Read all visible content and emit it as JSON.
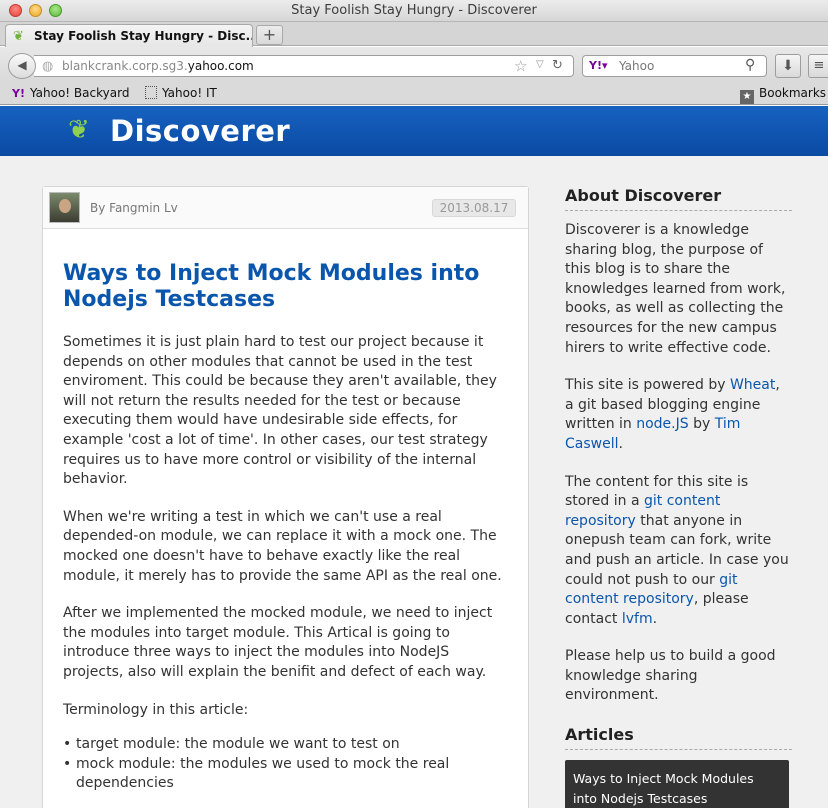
{
  "window": {
    "title": "Stay Foolish Stay Hungry - Discoverer"
  },
  "tab": {
    "label": "Stay Foolish Stay Hungry - Disc...",
    "new_tab": "+"
  },
  "urlbar": {
    "prefix": "blankcrank.corp.sg3.",
    "host": "yahoo.com"
  },
  "search": {
    "placeholder": "Yahoo"
  },
  "bookmarks": {
    "items": [
      "Yahoo! Backyard",
      "Yahoo! IT"
    ],
    "bookmarks_label": "Bookmarks"
  },
  "site": {
    "name": "Discoverer"
  },
  "post": {
    "author": "By Fangmin Lv",
    "date": "2013.08.17",
    "title": "Ways to Inject Mock Modules into Nodejs Testcases",
    "paragraphs": [
      "Sometimes it is just plain hard to test our project because it depends on other modules that cannot be used in the test enviroment. This could be because they aren't available, they will not return the results needed for the test or because executing them would have undesirable side effects, for example 'cost a lot of time'. In other cases, our test strategy requires us to have more control or visibility of the internal behavior.",
      "When we're writing a test in which we can't use a real depended-on module, we can replace it with a mock one. The mocked one doesn't have to behave exactly like the real module, it merely has to provide the same API as the real one.",
      "After we implemented the mocked module, we need to inject the modules into target module. This Artical is going to introduce three ways to inject the modules into NodeJS projects, also will explain the benifit and defect of each way.",
      "Terminology in this article:"
    ],
    "bullets": [
      "target module: the module we want to test on",
      "mock module: the modules we used to mock the real dependencies"
    ]
  },
  "sidebar": {
    "about_heading": "About Discoverer",
    "about_text": "Discoverer is a knowledge sharing blog, the purpose of this blog is to share the knowledges learned from work, books, as well as collecting the resources for the new campus hirers to write effective code.",
    "powered": {
      "t1": "This site is powered by ",
      "wheat": "Wheat",
      "t2": ", a git based blogging engine written in ",
      "node": "node.JS",
      "t3": " by ",
      "tim": "Tim Caswell",
      "t4": "."
    },
    "content": {
      "t1": "The content for this site is stored in a ",
      "repo1": "git content repository",
      "t2": " that anyone in onepush team can fork, write and push an article. In case you could not push to our ",
      "repo2": "git content repository",
      "t3": ", please contact ",
      "lvfm": "lvfm",
      "t4": "."
    },
    "help_text": "Please help us to build a good knowledge sharing environment.",
    "articles_heading": "Articles",
    "articles": [
      "Ways to Inject Mock Modules into Nodejs Testcases"
    ]
  }
}
